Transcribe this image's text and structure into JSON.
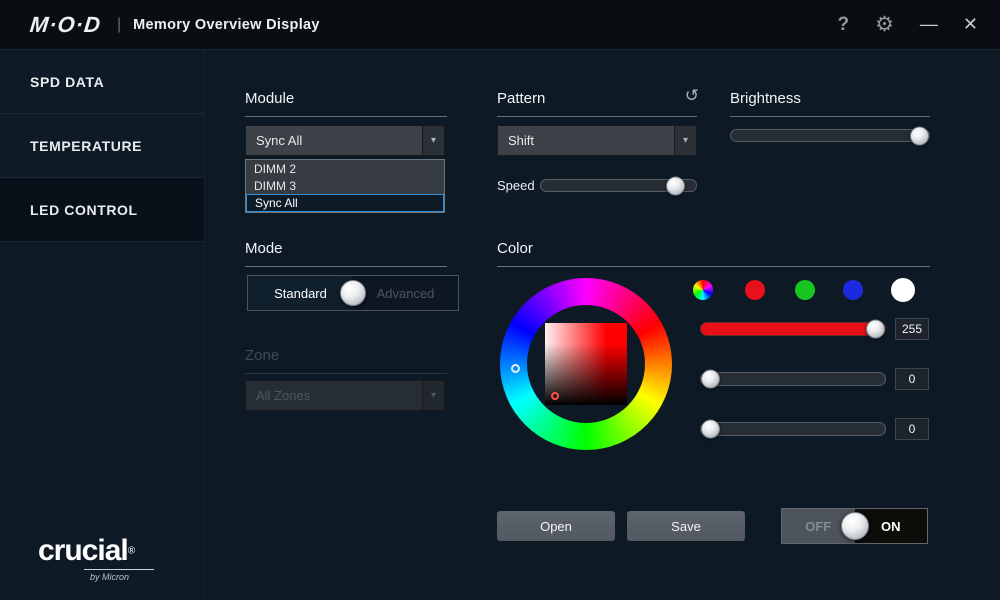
{
  "titlebar": {
    "logo": "M·O·D",
    "separator": "|",
    "title": "Memory Overview Display"
  },
  "icons": {
    "help": "?",
    "gear": "⚙",
    "minimize": "—",
    "close": "✕",
    "history": "↺",
    "dropdown": "▾",
    "registered": "®"
  },
  "sidebar": {
    "items": [
      {
        "label": "SPD DATA",
        "active": false
      },
      {
        "label": "TEMPERATURE",
        "active": false
      },
      {
        "label": "LED CONTROL",
        "active": true
      }
    ],
    "brand": {
      "name": "crucial",
      "tagline": "by Micron"
    }
  },
  "module": {
    "label": "Module",
    "selected": "Sync All",
    "options": [
      {
        "label": "DIMM 2"
      },
      {
        "label": "DIMM 3"
      },
      {
        "label": "Sync All",
        "selected": true
      }
    ]
  },
  "pattern": {
    "label": "Pattern",
    "selected": "Shift"
  },
  "speed": {
    "label": "Speed",
    "percent": 92
  },
  "brightness": {
    "label": "Brightness",
    "percent": 100
  },
  "mode": {
    "label": "Mode",
    "standard": "Standard",
    "advanced": "Advanced",
    "selected": "Standard"
  },
  "zone": {
    "label": "Zone",
    "selected": "All Zones",
    "disabled": true
  },
  "color": {
    "label": "Color",
    "presets": [
      {
        "name": "multicolor"
      },
      {
        "name": "red",
        "hex": "#e8101c"
      },
      {
        "name": "green",
        "hex": "#17c522"
      },
      {
        "name": "blue",
        "hex": "#1b2ae0"
      },
      {
        "name": "white",
        "hex": "#ffffff"
      }
    ],
    "channels": [
      {
        "name": "red",
        "value": "255",
        "percent": 100
      },
      {
        "name": "green",
        "value": "0",
        "percent": 0
      },
      {
        "name": "blue",
        "value": "0",
        "percent": 0
      }
    ]
  },
  "actions": {
    "open": "Open",
    "save": "Save"
  },
  "power": {
    "off": "OFF",
    "on": "ON",
    "state": "ON"
  }
}
